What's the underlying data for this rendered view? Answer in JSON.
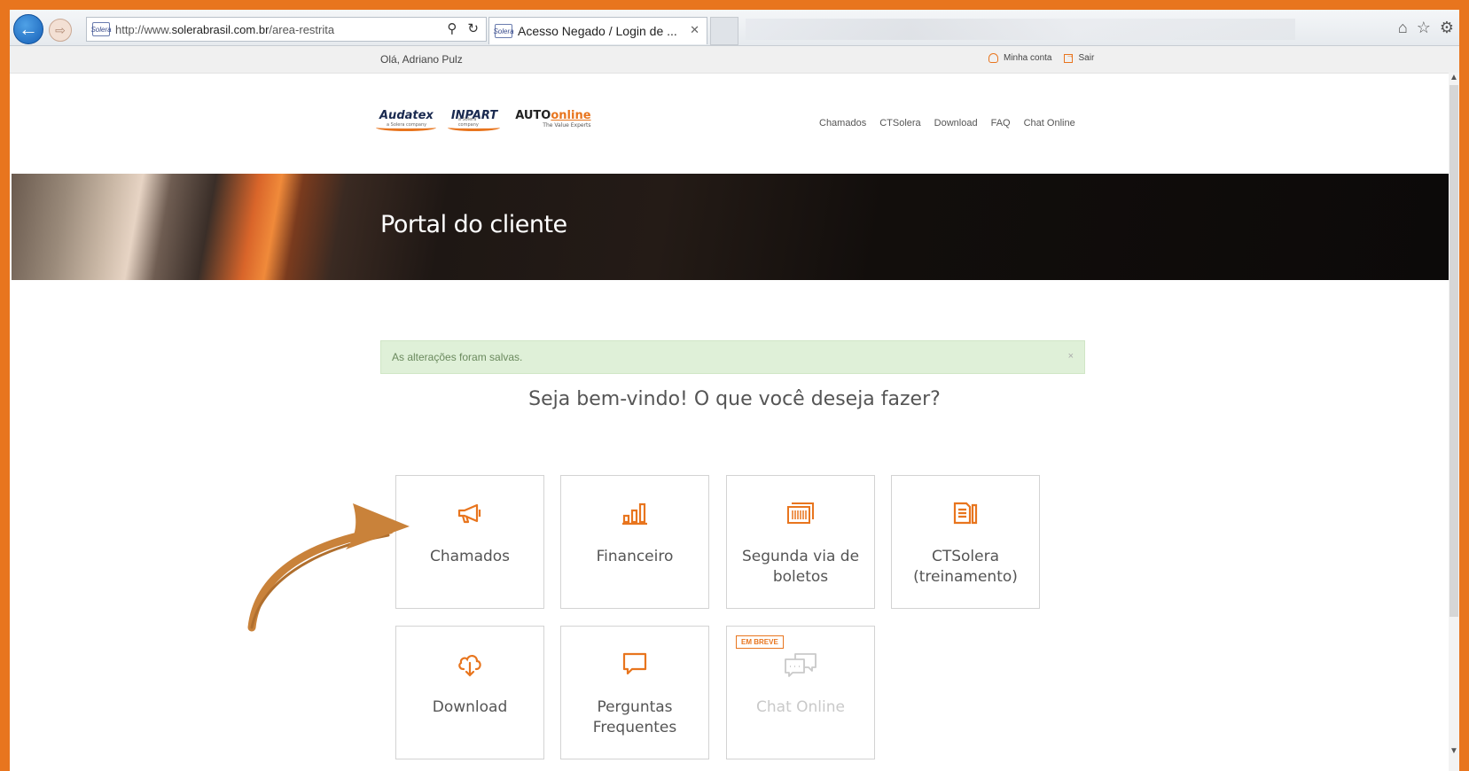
{
  "browser": {
    "url_prefix": "http://www.",
    "url_domain": "solerabrasil.com.br",
    "url_path": "/area-restrita",
    "tab_title": "Acesso Negado / Login de ...",
    "favicon_text": "Solera"
  },
  "userbar": {
    "greeting": "Olá, Adriano Pulz",
    "my_account": "Minha conta",
    "logout": "Sair"
  },
  "logos": {
    "audatex": "Audatex",
    "inpart": "INPART",
    "sub": "a Solera company",
    "auto": "AUTO",
    "online": "online",
    "tagline": "The Value Experts"
  },
  "nav": [
    "Chamados",
    "CTSolera",
    "Download",
    "FAQ",
    "Chat Online"
  ],
  "banner": {
    "title": "Portal do cliente"
  },
  "alert": {
    "message": "As alterações foram salvas.",
    "close": "×"
  },
  "welcome": "Seja bem-vindo! O que você deseja fazer?",
  "tiles": [
    {
      "label": "Chamados",
      "icon": "megaphone-icon"
    },
    {
      "label": "Financeiro",
      "icon": "bar-chart-icon"
    },
    {
      "label": "Segunda via de boletos",
      "icon": "barcode-icon"
    },
    {
      "label": "CTSolera (treinamento)",
      "icon": "document-icon"
    },
    {
      "label": "Download",
      "icon": "cloud-download-icon"
    },
    {
      "label": "Perguntas Frequentes",
      "icon": "speech-bubble-icon"
    },
    {
      "label": "Chat Online",
      "icon": "chat-bubbles-icon",
      "badge": "EM BREVE"
    }
  ],
  "colors": {
    "accent": "#e8751e",
    "alert_bg": "#dff0d8",
    "banner_bg": "#111111"
  }
}
